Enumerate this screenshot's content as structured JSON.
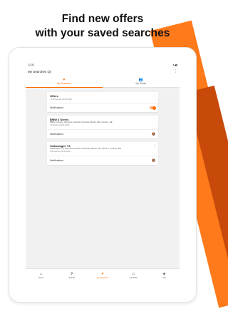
{
  "headline": {
    "line1": "Find new offers",
    "line2": "with your saved searches"
  },
  "colors": {
    "accent": "#ff6a00",
    "stripe_light": "#ff7a1a",
    "stripe_dark": "#c84a0a"
  },
  "status_bar": {
    "time": "12:30",
    "icons": "▾◢▮"
  },
  "app_bar": {
    "title": "My Searches (3)"
  },
  "tabs": [
    {
      "label": "My Searches",
      "icon": "search-heart-icon",
      "active": true
    },
    {
      "label": "My Dealer",
      "icon": "people-icon",
      "active": false
    }
  ],
  "searches": [
    {
      "title": "Offers",
      "subtitle": "",
      "count": "1,128 Results (20.08.2022)",
      "notifications_label": "Notifications",
      "notifications_on": true
    },
    {
      "title": "BMW 3 Series",
      "subtitle": "BMW 3 Series, Payment method: Purchase, Berlin, DE, Country: DE",
      "count": "12 Results (20.08.2022)",
      "notifications_label": "Notifications",
      "notifications_on": false
    },
    {
      "title": "Volkswagen T3",
      "subtitle": "Volkswagen T3, Payment method: Purchase, Berlin, DE, 100 km, Country: DE",
      "count": "130 Results (20.08.2022)",
      "notifications_label": "Notifications",
      "notifications_on": false
    }
  ],
  "bottom_nav": [
    {
      "label": "Home",
      "icon": "home-icon",
      "active": false
    },
    {
      "label": "Search",
      "icon": "search-icon",
      "active": false
    },
    {
      "label": "My Searches",
      "icon": "heart-search-icon",
      "active": true
    },
    {
      "label": "Car Park",
      "icon": "car-park-icon",
      "active": false
    },
    {
      "label": "Sell",
      "icon": "tag-icon",
      "active": false
    }
  ]
}
